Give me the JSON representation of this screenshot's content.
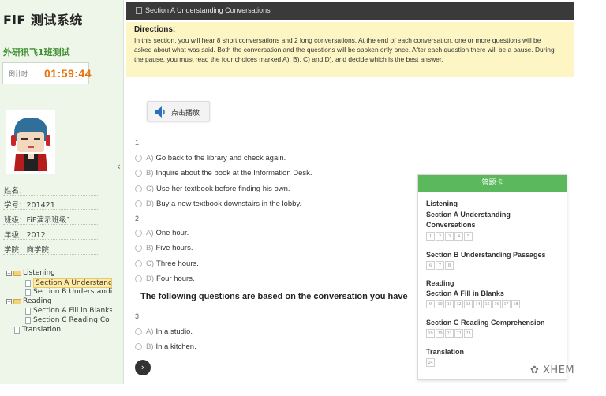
{
  "sidebar": {
    "logo": "FiF 测试系统",
    "class_name": "外研讯飞1班测试",
    "timer_label": "倒计时",
    "timer_value": "01:59:44",
    "name_label": "姓名：",
    "student_id": "学号：201421",
    "class_info": "班级：FiF演示班级1",
    "grade": "年级：2012",
    "college": "学院：商学院",
    "collapse_icon": "chevron-left-icon",
    "tree": {
      "listening": "Listening",
      "section_a": "Section A Understandi",
      "section_b": "Section B Understandi",
      "reading": "Reading",
      "section_a_fill": "Section A Fill in Blanks",
      "section_c": "Section C Reading Co",
      "translation": "Translation"
    }
  },
  "header": {
    "title": "Section A Understanding Conversations"
  },
  "directions": {
    "title": "Directions:",
    "text": "In this section, you will hear 8 short conversations and 2 long conversations. At the end of each conversation, one or more questions will be asked about what was said. Both the conversation and the questions will be spoken only once. After each question there will be a pause. During the pause, you must read the four choices marked A), B), C) and D), and decide which is the best answer."
  },
  "play_button": {
    "label": "点击播放",
    "icon": "speaker-icon"
  },
  "questions": [
    {
      "number": "1",
      "options": [
        {
          "letter": "A)",
          "text": "Go back to the library and check again."
        },
        {
          "letter": "B)",
          "text": "Inquire about the book at the Information Desk."
        },
        {
          "letter": "C)",
          "text": "Use her textbook before finding his own."
        },
        {
          "letter": "D)",
          "text": "Buy a new textbook downstairs in the lobby."
        }
      ]
    },
    {
      "number": "2",
      "options": [
        {
          "letter": "A)",
          "text": "One hour."
        },
        {
          "letter": "B)",
          "text": "Five hours."
        },
        {
          "letter": "C)",
          "text": "Three hours."
        },
        {
          "letter": "D)",
          "text": "Four hours."
        }
      ]
    },
    {
      "number": "3",
      "options": [
        {
          "letter": "A)",
          "text": "In a studio."
        },
        {
          "letter": "B)",
          "text": "In a kitchen."
        }
      ]
    }
  ],
  "instruction": "The following questions are based on the conversation you have",
  "next_button": "›",
  "answer_card": {
    "title": "答题卡",
    "listening": "Listening",
    "section_a_line1": "Section A Understanding",
    "section_a_line2": "Conversations",
    "section_a_nums": [
      "1",
      "2",
      "3",
      "4",
      "5"
    ],
    "section_b": "Section B Understanding Passages",
    "section_b_nums": [
      "6",
      "7",
      "8"
    ],
    "reading": "Reading",
    "reading_a": "Section A Fill in Blanks",
    "reading_a_nums": [
      "9",
      "10",
      "11",
      "12",
      "13",
      "14",
      "15",
      "16",
      "17",
      "18"
    ],
    "reading_c": "Section C Reading Comprehension",
    "reading_c_nums": [
      "19",
      "20",
      "21",
      "22",
      "23"
    ],
    "translation": "Translation",
    "translation_nums": [
      "24"
    ]
  },
  "watermark": "XHEM",
  "colors": {
    "sidebar_bg": "#eef5e9",
    "accent_green": "#5cb85c",
    "timer_orange": "#e8730c",
    "header_bg": "#3a3a3a",
    "directions_bg": "#fdf6c4"
  }
}
